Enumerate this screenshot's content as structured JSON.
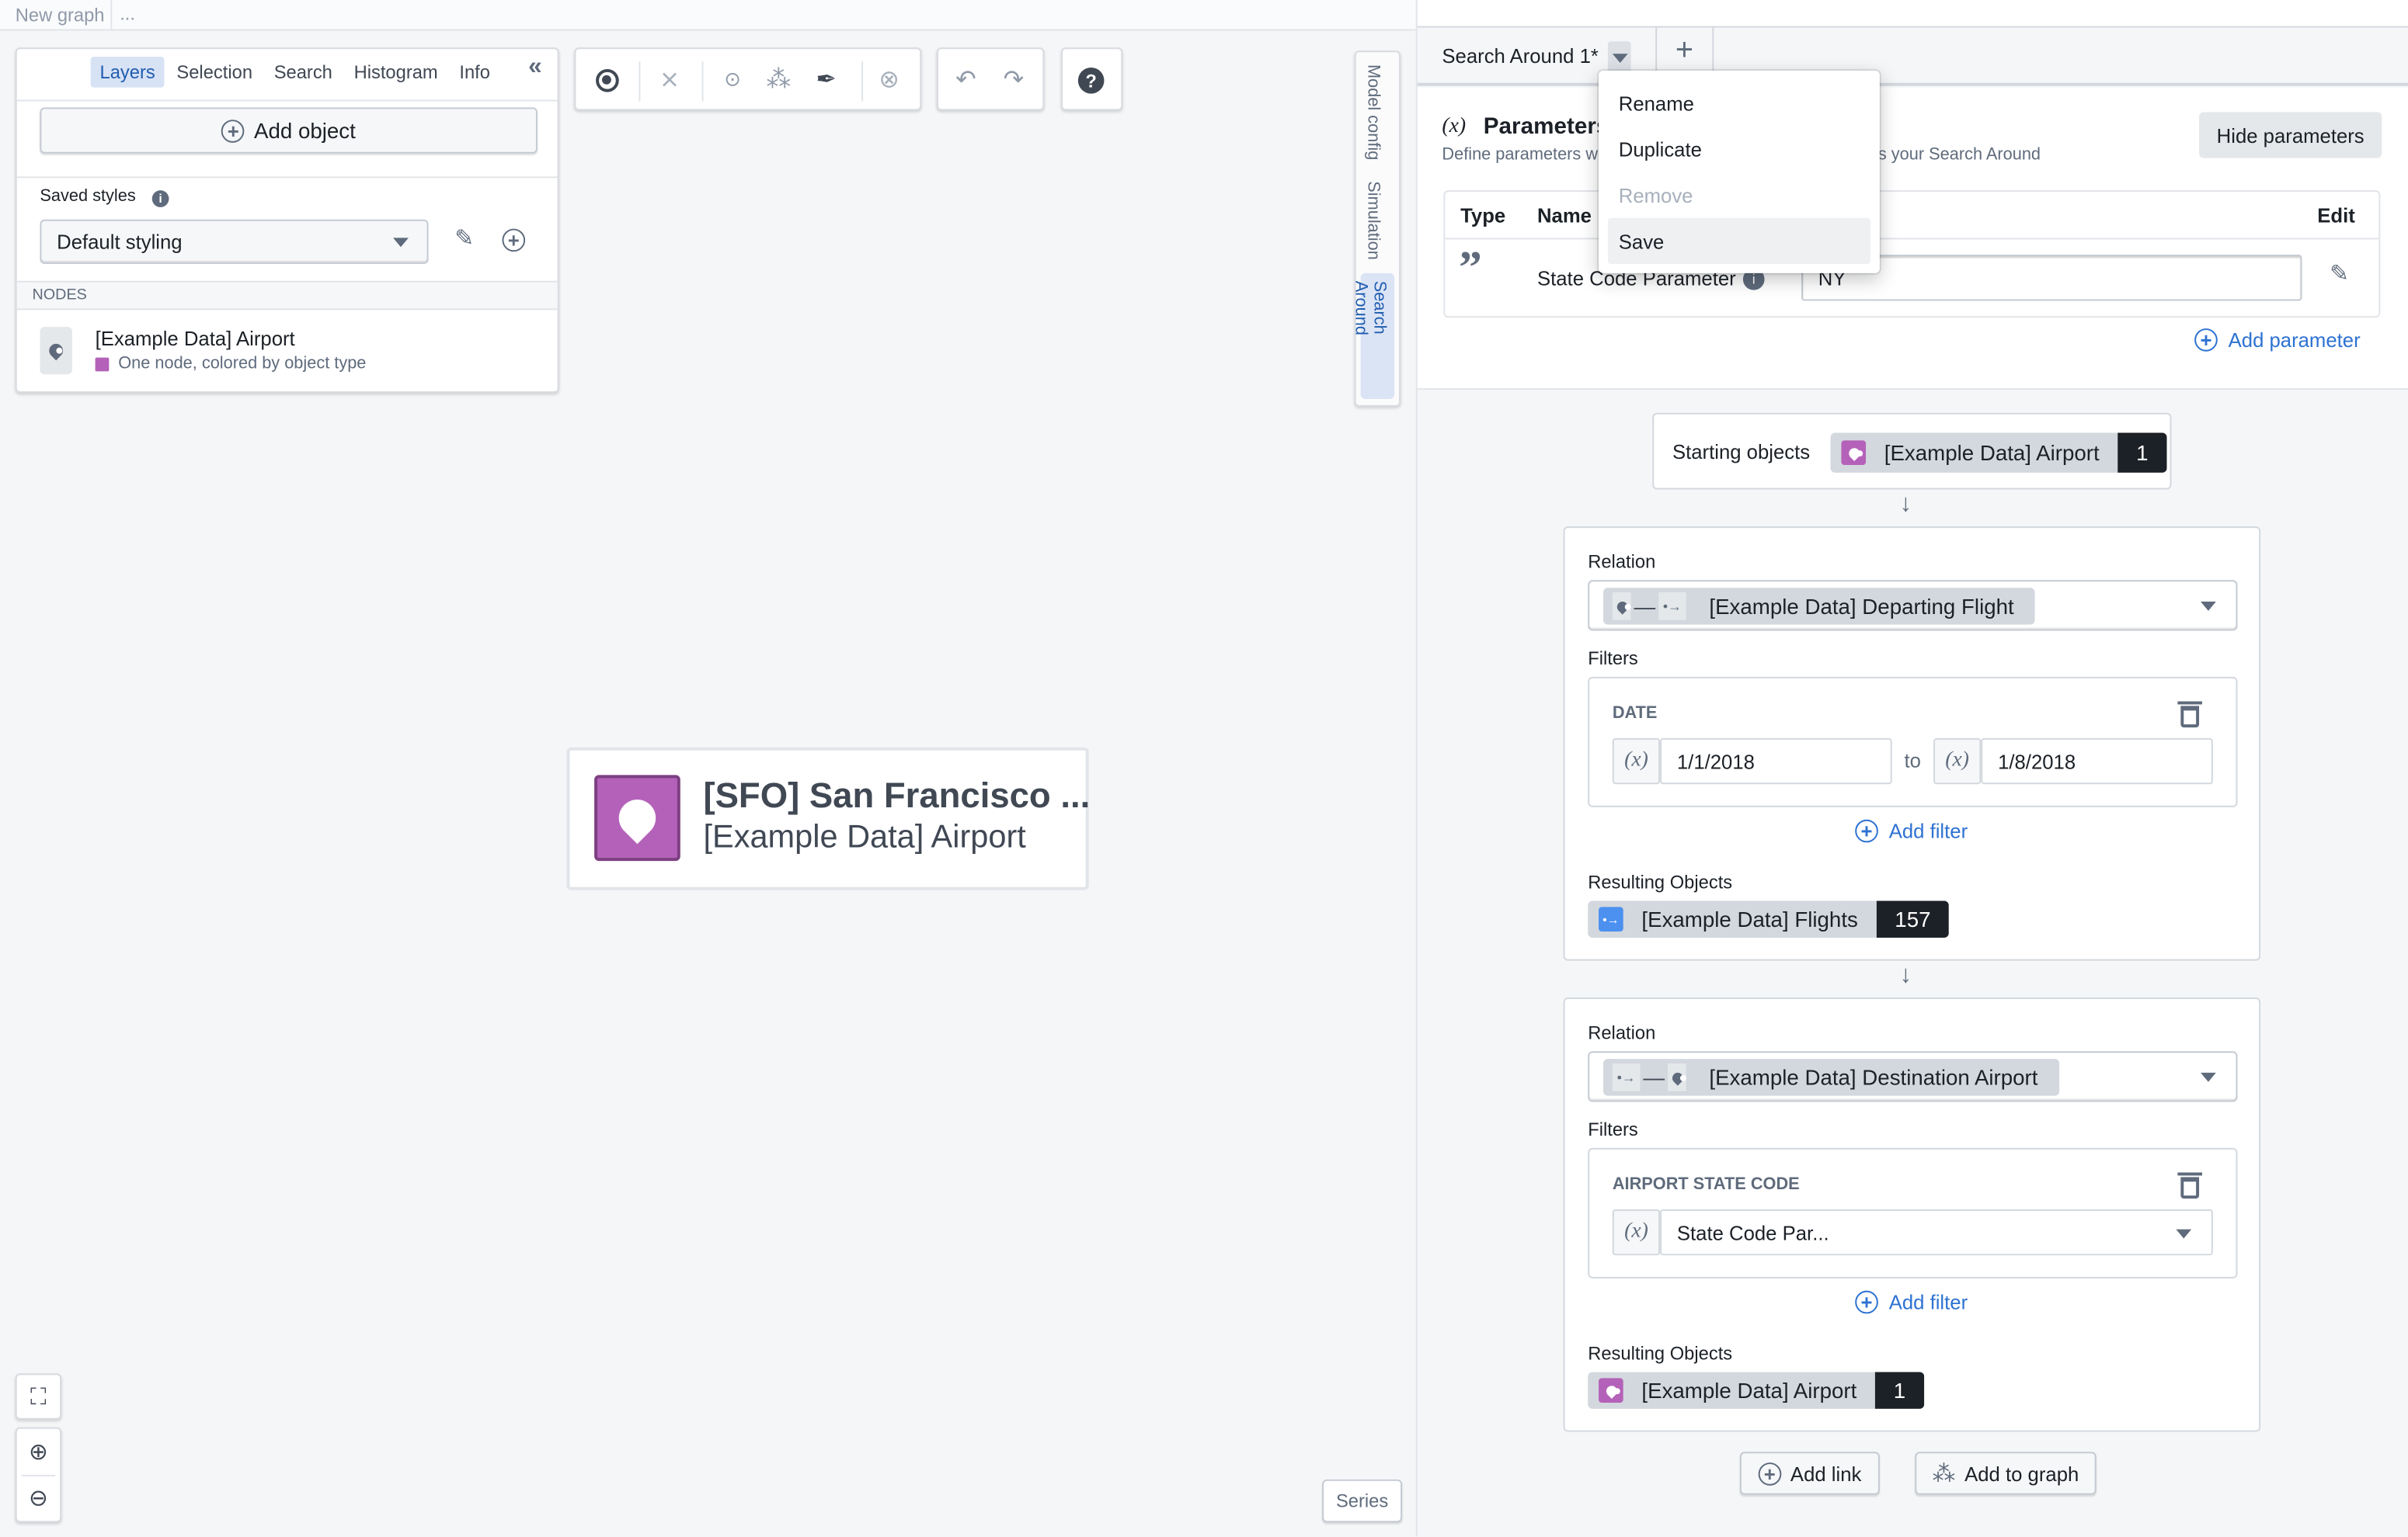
{
  "topbar": {
    "title": "New graph",
    "more": "..."
  },
  "left_panel": {
    "tabs": [
      {
        "label": "Layers",
        "active": true
      },
      {
        "label": "Selection"
      },
      {
        "label": "Search"
      },
      {
        "label": "Histogram"
      },
      {
        "label": "Info"
      }
    ],
    "collapse_icon": "double-chevron-left-icon",
    "add_object": "Add object",
    "saved_styles_label": "Saved styles",
    "saved_style_value": "Default styling",
    "nodes_header": "NODES",
    "node": {
      "title": "[Example Data] Airport",
      "subtitle": "One node, colored by object type",
      "color": "#b462b9"
    }
  },
  "toolbar": {
    "icons": [
      "select-icon",
      "layout-icon",
      "link-icon",
      "graph-icon",
      "pen-icon",
      "remove-icon",
      "undo-icon",
      "redo-icon",
      "help-icon"
    ]
  },
  "side_tabs": [
    {
      "label": "Model config"
    },
    {
      "label": "Simulation"
    },
    {
      "label": "Search Around",
      "active": true
    }
  ],
  "canvas_node": {
    "title": "[SFO] San Francisco ...",
    "subtitle": "[Example Data] Airport",
    "color": "#b462b9"
  },
  "series_button": "Series",
  "right_panel": {
    "tab_label": "Search Around 1*",
    "add_tab": "+",
    "menu": [
      {
        "label": "Rename"
      },
      {
        "label": "Duplicate"
      },
      {
        "label": "Remove",
        "disabled": true
      },
      {
        "label": "Save",
        "highlighted": true
      }
    ],
    "params_title": "Parameters",
    "params_icon": "(x)",
    "params_desc_left": "Define parameters w",
    "params_desc_right": "s your Search Around",
    "hide_params": "Hide parameters",
    "table_headers": {
      "type": "Type",
      "name": "Name",
      "edit": "Edit"
    },
    "param": {
      "name": "State Code Parameter",
      "value": "NY",
      "type_icon": "quote-icon"
    },
    "add_parameter": "Add parameter",
    "starting": {
      "label": "Starting objects",
      "object": "[Example Data] Airport",
      "count": "1"
    },
    "steps": [
      {
        "relation_label": "Relation",
        "relation": "[Example Data] Departing Flight",
        "filters_label": "Filters",
        "filter": {
          "name": "DATE",
          "var": "(x)",
          "from": "1/1/2018",
          "to_label": "to",
          "to": "1/8/2018"
        },
        "add_filter": "Add filter",
        "result_label": "Resulting Objects",
        "result": "[Example Data] Flights",
        "result_count": "157"
      },
      {
        "relation_label": "Relation",
        "relation": "[Example Data] Destination Airport",
        "filters_label": "Filters",
        "filter": {
          "name": "AIRPORT STATE CODE",
          "var": "(x)",
          "value": "State Code Par..."
        },
        "add_filter": "Add filter",
        "result_label": "Resulting Objects",
        "result": "[Example Data] Airport",
        "result_count": "1"
      }
    ],
    "add_link": "Add link",
    "add_to_graph": "Add to graph"
  },
  "colors": {
    "accent": "#2d72d2",
    "airport": "#b462b9",
    "flight": "#4c90f0"
  }
}
